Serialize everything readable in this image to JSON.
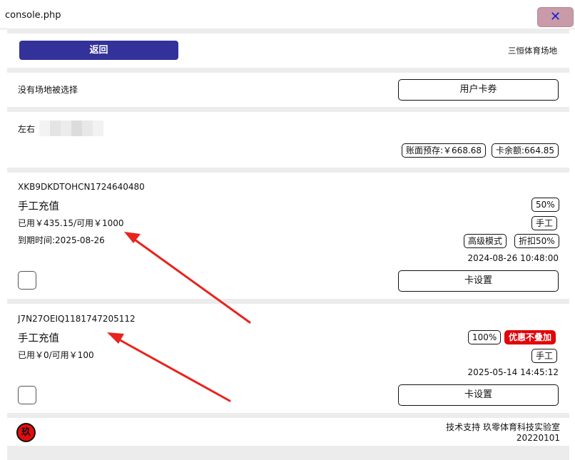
{
  "window": {
    "title": "console.php",
    "close_glyph": "✕"
  },
  "header": {
    "back_label": "返回",
    "venue_name": "三恒体育场地"
  },
  "venue_row": {
    "status_text": "没有场地被选择",
    "user_coupon_button": "用户卡券"
  },
  "account": {
    "user_label": "左右",
    "book_balance": "账面预存:￥668.68",
    "card_balance": "卡余额:664.85"
  },
  "cards": [
    {
      "card_no": "XKB9DKDTOHCN1724640480",
      "title": "手工充值",
      "usage": "已用￥435.15/可用￥1000",
      "expiry": "到期时间:2025-08-26",
      "tags": [
        "50%",
        "手工",
        "高级模式",
        "折扣50%"
      ],
      "date": "2024-08-26 10:48:00",
      "settings_button": "卡设置"
    },
    {
      "card_no": "J7N27OEIQ1181747205112",
      "title": "手工充值",
      "usage": "已用￥0/可用￥100",
      "tags": [
        "100%",
        "优惠不叠加",
        "手工"
      ],
      "date": "2025-05-14 14:45:12",
      "settings_button": "卡设置"
    }
  ],
  "footer": {
    "logo_char": "玖",
    "support_text": "技术支持 玖零体育科技实验室",
    "version": "20220101"
  },
  "colors": {
    "primary": "#33329a",
    "close_bg": "#c99aa8",
    "red_tag": "#e3050a",
    "arrow": "#e8231d",
    "divider": "#ececec"
  }
}
